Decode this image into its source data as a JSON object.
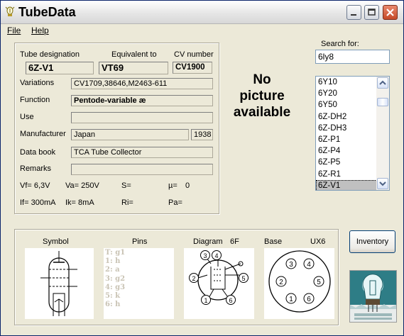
{
  "window": {
    "title": "TubeData"
  },
  "menu": {
    "file": "File",
    "help": "Help"
  },
  "labels": {
    "tube_designation": "Tube designation",
    "equivalent_to": "Equivalent to",
    "cv_number": "CV number",
    "variations": "Variations",
    "function": "Function",
    "use": "Use",
    "manufacturer": "Manufacturer",
    "data_book": "Data book",
    "remarks": "Remarks"
  },
  "fields": {
    "tube_designation": "6Z-V1",
    "equivalent_to": "VT69",
    "cv_number": "CV1900",
    "variations": "CV1709,38646,M2463-611",
    "function": "Pentode-variable æ",
    "use": "",
    "manufacturer": "Japan",
    "year": "1938",
    "data_book": "TCA Tube Collector",
    "remarks": ""
  },
  "params": {
    "vf": "Vf= 6,3V",
    "va": "Va= 250V",
    "s": "S=",
    "mu": "µ=",
    "mu_value": "0",
    "if": "If= 300mA",
    "ik": "Ik=  8mA",
    "ri": "Ri=",
    "pa": "Pa="
  },
  "picture": {
    "line1": "No",
    "line2": "picture",
    "line3": "available"
  },
  "search": {
    "label": "Search for:",
    "value": "6ly8"
  },
  "tube_list": [
    "6Y10",
    "6Y20",
    "6Y50",
    "6Z-DH2",
    "6Z-DH3",
    "6Z-P1",
    "6Z-P4",
    "6Z-P5",
    "6Z-R1",
    "6Z-V1"
  ],
  "selected_tube": "6Z-V1",
  "bottom": {
    "symbol": "Symbol",
    "pins": "Pins",
    "diagram": "Diagram",
    "diagram_code": "6F",
    "base": "Base",
    "base_code": "UX6"
  },
  "pins_list": [
    "T: g1",
    "1: h",
    "2: a",
    "3: g2",
    "4: g3",
    "5: k",
    "6: h"
  ],
  "diagram_pins": [
    "1",
    "2",
    "3",
    "4",
    "5",
    "6"
  ],
  "base_pins": [
    "1",
    "2",
    "3",
    "4",
    "5",
    "6"
  ],
  "inventory_button": "Inventory"
}
